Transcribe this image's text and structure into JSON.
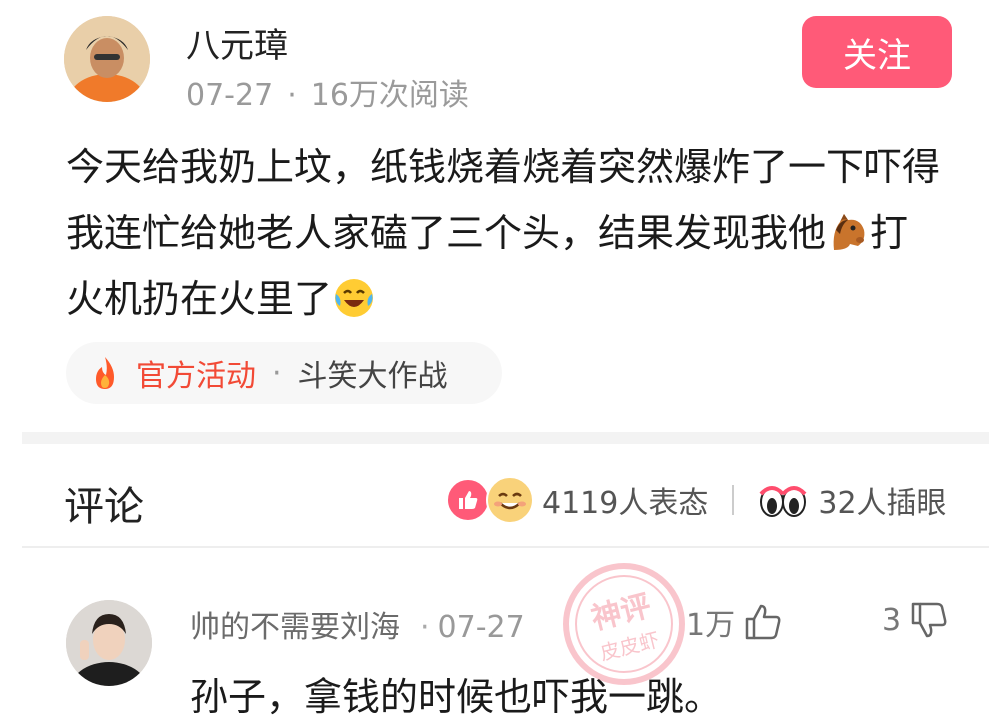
{
  "post": {
    "author": "八元璋",
    "date": "07-27",
    "meta_separator": "·",
    "views": "16万次阅读",
    "follow_label": "关注",
    "body_part1": "今天给我奶上坟，纸钱烧着烧着突然爆炸了一下吓得我连忙给她老人家磕了三个头，结果发现我他",
    "body_horse_icon": "horse-face-emoji",
    "body_part2": "打火机扔在火里了",
    "body_end_icon": "laughing-crying-emoji",
    "activity": {
      "icon": "fire-icon",
      "label": "官方活动",
      "separator": "·",
      "name": "斗笑大作战"
    }
  },
  "comments_section": {
    "title": "评论",
    "reaction_count": "4119人表态",
    "eyes_count": "32人插眼",
    "colors": {
      "accent": "#ff5a78",
      "activity": "#f24a36"
    }
  },
  "comment": {
    "username": "帅的不需要刘海",
    "separator": "·",
    "date": "07-27",
    "likes": "1万",
    "dislikes": "3",
    "text": "孙子，拿钱的时候也吓我一跳。"
  },
  "watermark": {
    "line1": "神评",
    "line2": "皮皮虾"
  }
}
